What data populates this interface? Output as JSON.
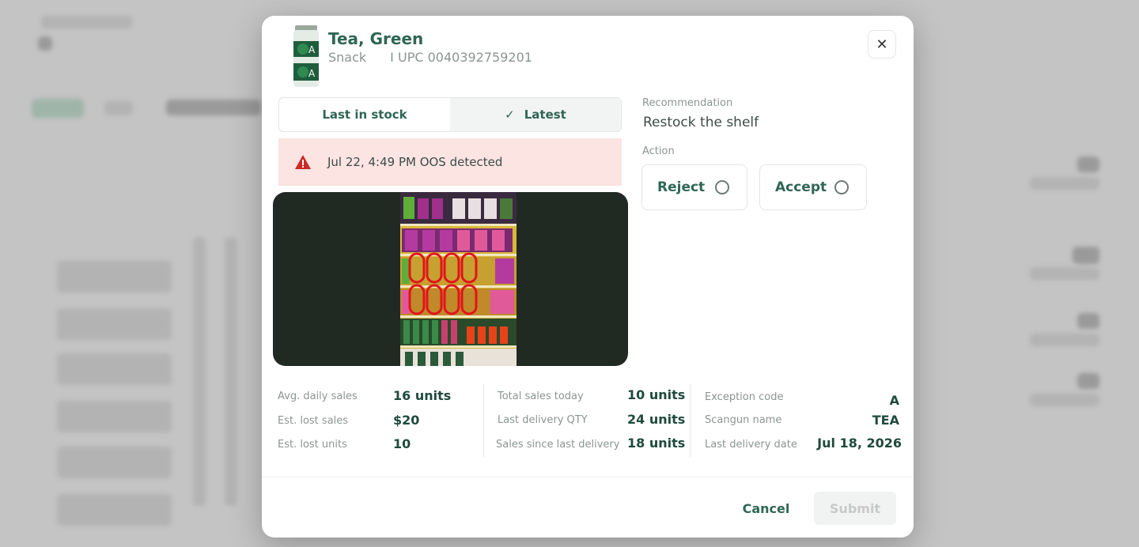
{
  "product": {
    "name": "Tea, Green",
    "category": "Snack",
    "upc_text": "I UPC 0040392759201",
    "thumb_letter": "A"
  },
  "tabs": [
    {
      "label": "Last in stock",
      "active": false
    },
    {
      "label": "Latest",
      "active": true
    }
  ],
  "alert": {
    "text": "Jul 22, 4:49 PM OOS detected"
  },
  "recommendation": {
    "label": "Recommendation",
    "value": "Restock the shelf"
  },
  "action": {
    "label": "Action",
    "reject_label": "Reject",
    "accept_label": "Accept",
    "selected": null
  },
  "stats": {
    "avg_daily_sales": {
      "label": "Avg. daily sales",
      "value": "16 units"
    },
    "est_lost_sales": {
      "label": "Est. lost sales",
      "value": "$20"
    },
    "est_lost_units": {
      "label": "Est. lost units",
      "value": "10"
    },
    "total_sales_today": {
      "label": "Total sales today",
      "value": "10 units"
    },
    "last_delivery_qty": {
      "label": "Last delivery QTY",
      "value": "24 units"
    },
    "sales_since_last_delivery": {
      "label": "Sales since last delivery",
      "value": "18 units"
    },
    "exception_code": {
      "label": "Exception code",
      "value": "A"
    },
    "scangun_name": {
      "label": "Scangun name",
      "value": "TEA"
    },
    "last_delivery_date": {
      "label": "Last delivery date",
      "value": "Jul 18, 2026"
    }
  },
  "footer": {
    "cancel_label": "Cancel",
    "submit_label": "Submit",
    "submit_disabled": true
  },
  "colors": {
    "accent": "#2f6655",
    "alert_bg": "#fbe4e2",
    "alert_icon": "#c92a2a",
    "photo_bg": "#212a22"
  },
  "icons": {
    "close": "close-icon",
    "check": "check-icon",
    "warning": "warning-triangle-icon"
  }
}
